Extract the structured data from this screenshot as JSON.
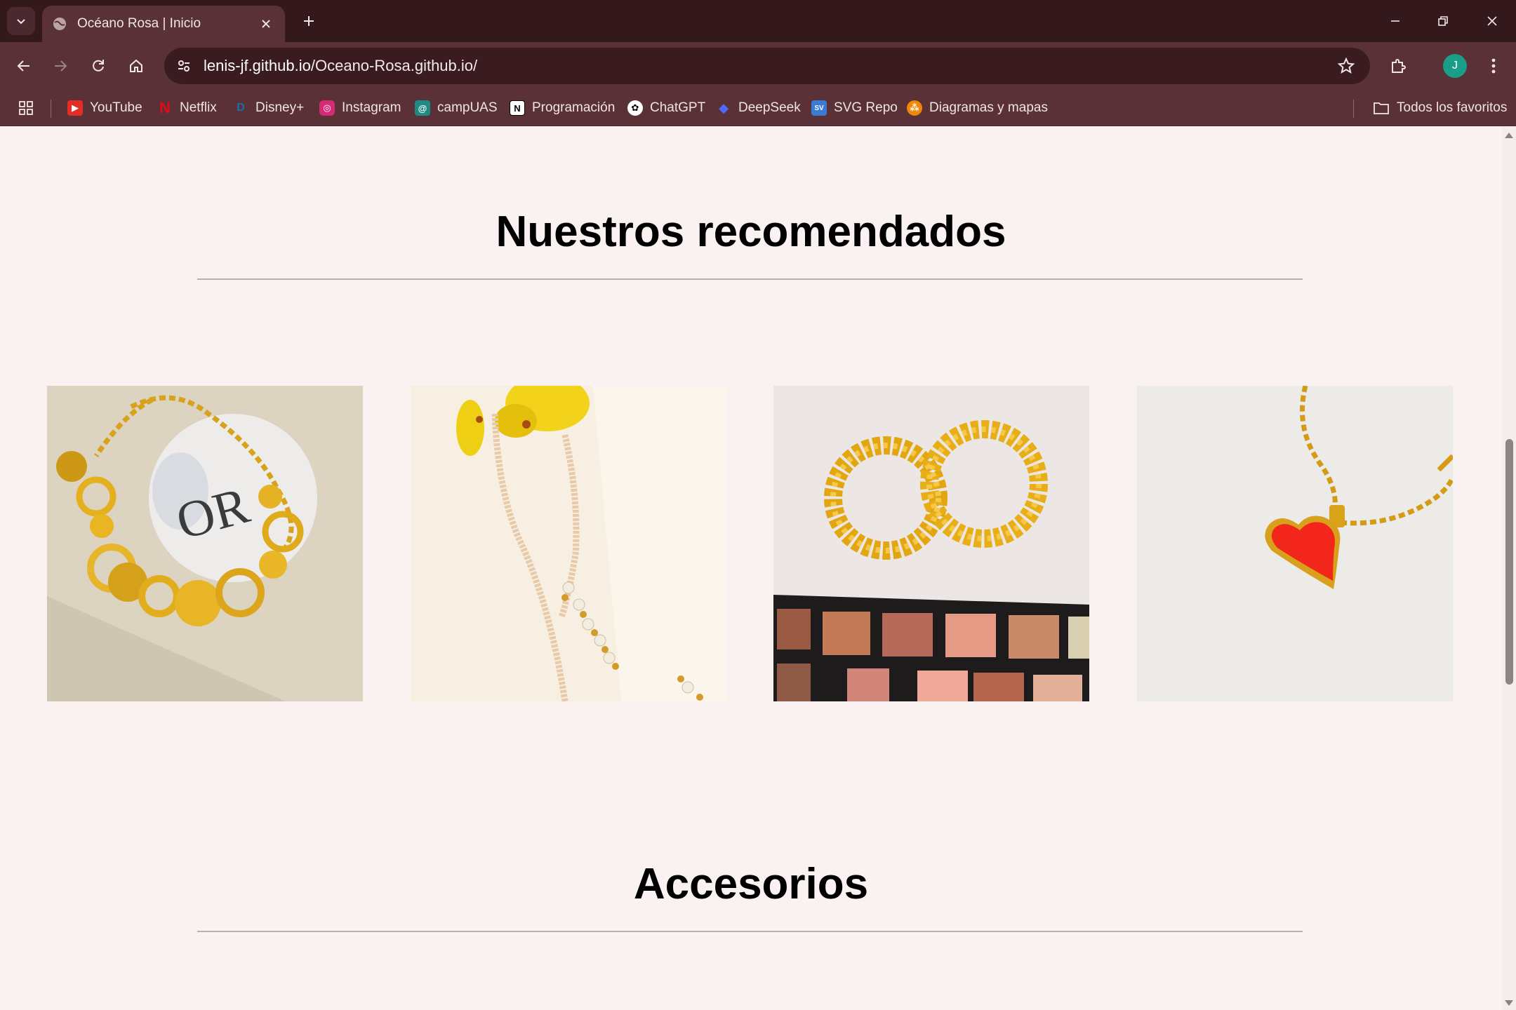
{
  "browser": {
    "tab": {
      "title": "Océano Rosa | Inicio"
    },
    "url": {
      "host": "lenis-jf.github.io",
      "path": "/Oceano-Rosa.github.io/"
    },
    "profile_initial": "J",
    "bookmarks": [
      {
        "label": "YouTube",
        "icon": "youtube-icon"
      },
      {
        "label": "Netflix",
        "icon": "netflix-icon"
      },
      {
        "label": "Disney+",
        "icon": "disney-icon"
      },
      {
        "label": "Instagram",
        "icon": "instagram-icon"
      },
      {
        "label": "campUAS",
        "icon": "campuas-icon"
      },
      {
        "label": "Programación",
        "icon": "notion-icon"
      },
      {
        "label": "ChatGPT",
        "icon": "chatgpt-icon"
      },
      {
        "label": "DeepSeek",
        "icon": "deepseek-icon"
      },
      {
        "label": "SVG Repo",
        "icon": "svgrepo-icon"
      },
      {
        "label": "Diagramas y mapas",
        "icon": "diagrams-icon"
      }
    ],
    "all_bookmarks_label": "Todos los favoritos"
  },
  "page": {
    "recommended_title": "Nuestros recomendados",
    "products": [
      {
        "name": "gold-disc-necklace"
      },
      {
        "name": "pearl-necklace"
      },
      {
        "name": "gold-hoop-earrings"
      },
      {
        "name": "red-heart-pendant"
      }
    ],
    "accessories_title": "Accesorios"
  }
}
